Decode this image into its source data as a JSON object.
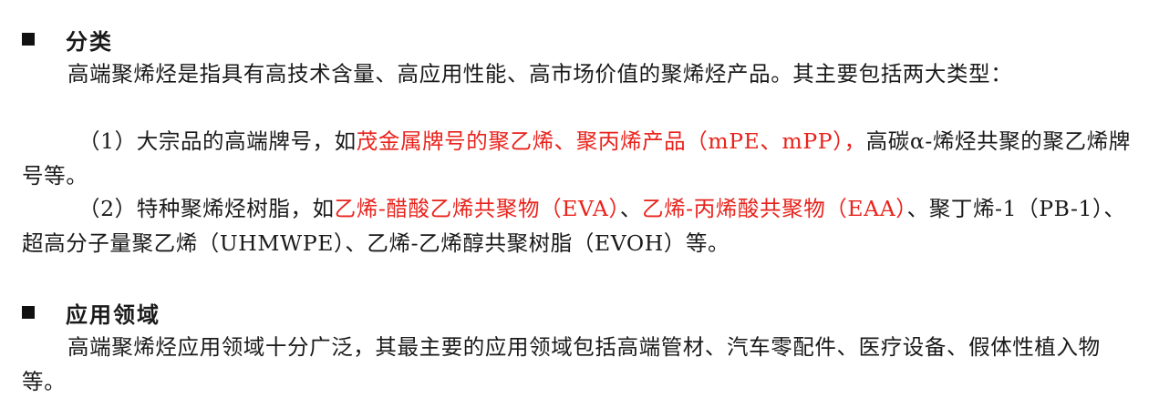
{
  "section1": {
    "heading": "分类",
    "intro": "高端聚烯烃是指具有高技术含量、高应用性能、高市场价值的聚烯烃产品。其主要包括两大类型：",
    "item1": {
      "prefix": "（1）大宗品的高端牌号，如",
      "highlight": "茂金属牌号的聚乙烯、聚丙烯产品（mPE、mPP），",
      "suffix": "高碳α-烯烃共聚的聚乙烯牌号等。"
    },
    "item2": {
      "prefix": "（2）特种聚烯烃树脂，如",
      "highlight1": "乙烯-醋酸乙烯共聚物（EVA）",
      "sep": "、",
      "highlight2": "乙烯-丙烯酸共聚物（EAA）",
      "suffix": "、聚丁烯-1（PB-1）、超高分子量聚乙烯（UHMWPE）、乙烯-乙烯醇共聚树脂（EVOH）等。"
    }
  },
  "section2": {
    "heading": "应用领域",
    "body": "高端聚烯烃应用领域十分广泛，其最主要的应用领域包括高端管材、汽车零配件、医疗设备、假体性植入物等。"
  },
  "colors": {
    "highlight": "#e8231c",
    "text": "#1a1a1a"
  }
}
